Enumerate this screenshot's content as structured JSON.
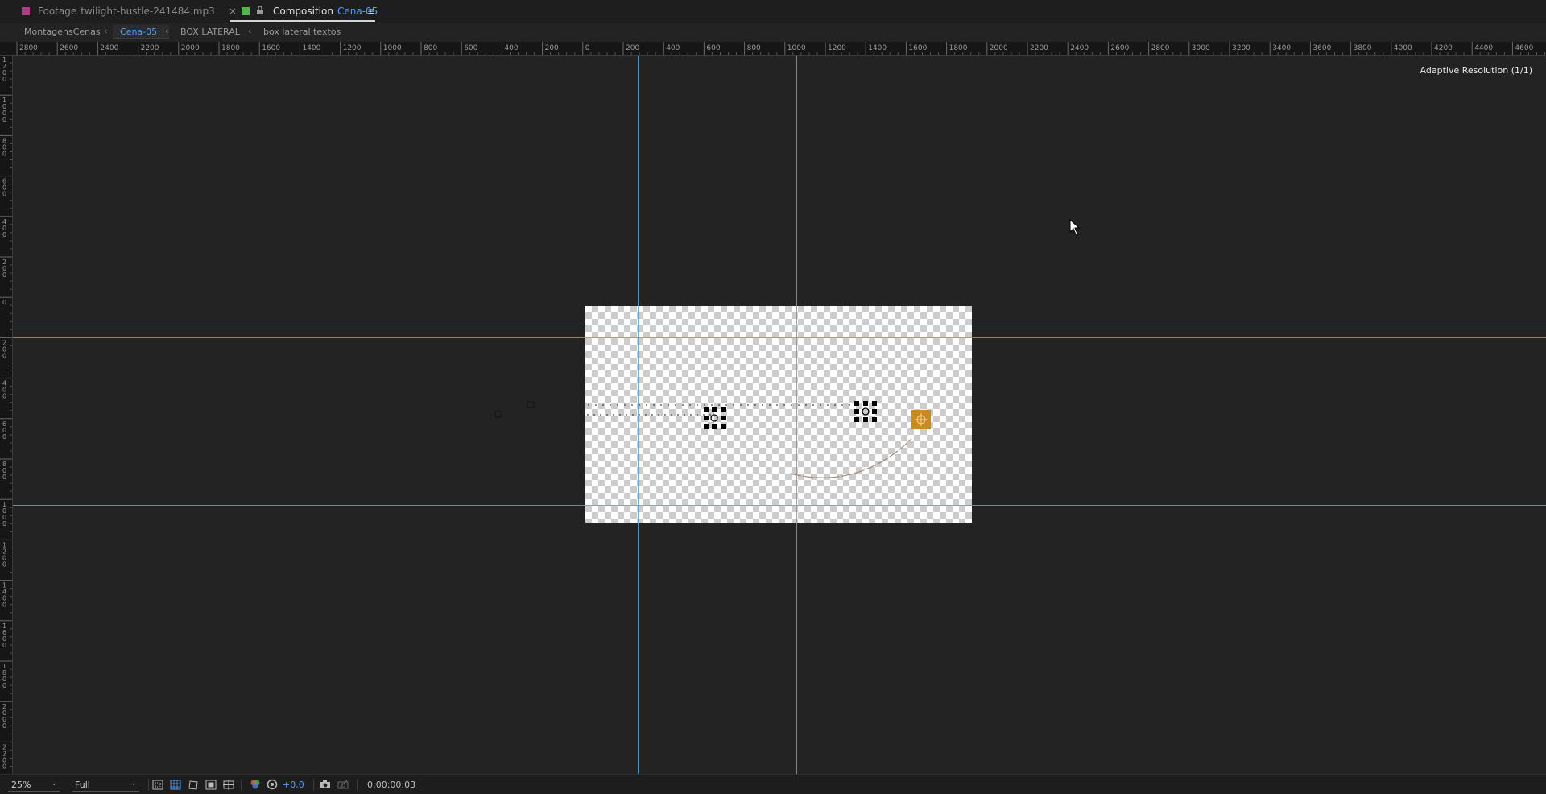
{
  "tabs": {
    "footage": {
      "kind": "Footage",
      "name": "twilight-hustle-241484.mp3",
      "color": "#b23c86"
    },
    "close_glyph": "×",
    "composition": {
      "kind": "Composition",
      "name": "Cena-05",
      "color": "#4fb64b"
    },
    "menu_glyph": "≡"
  },
  "breadcrumbs": {
    "items": [
      "MontagensCenas",
      "Cena-05",
      "BOX LATERAL",
      "box lateral textos"
    ],
    "separator": "‹",
    "active_index": 1
  },
  "ruler": {
    "horizontal_labels": [
      "2800",
      "2600",
      "2400",
      "2200",
      "2000",
      "1800",
      "1600",
      "1400",
      "1200",
      "1000",
      "800",
      "600",
      "400",
      "200",
      "0",
      "200",
      "400",
      "600",
      "800",
      "1000",
      "1200",
      "1400",
      "1600",
      "1800",
      "2000",
      "2200",
      "2400",
      "2600",
      "2800",
      "3000",
      "3200",
      "3400",
      "3600",
      "3800",
      "4000",
      "4200",
      "4400",
      "4600"
    ],
    "vertical_labels": [
      "1200",
      "1000",
      "800",
      "600",
      "400",
      "200",
      "0",
      "200",
      "400",
      "600",
      "800",
      "1000",
      "1200",
      "1400",
      "1600",
      "1800",
      "2000",
      "2200"
    ]
  },
  "viewer": {
    "adaptive_resolution": "Adaptive Resolution (1/1)",
    "guide_color": "#4aa8d8",
    "keyframe_color": "#c98a1e"
  },
  "bottombar": {
    "zoom": "25%",
    "resolution": "Full",
    "exposure": "+0,0",
    "timecode": "0:00:00:03",
    "icons": [
      "region-of-interest-icon",
      "transparency-grid-icon",
      "mask-visibility-icon",
      "safe-zones-icon",
      "grid-guides-icon",
      "color-channels-icon",
      "color-management-icon",
      "snapshot-icon",
      "show-snapshot-icon"
    ]
  }
}
